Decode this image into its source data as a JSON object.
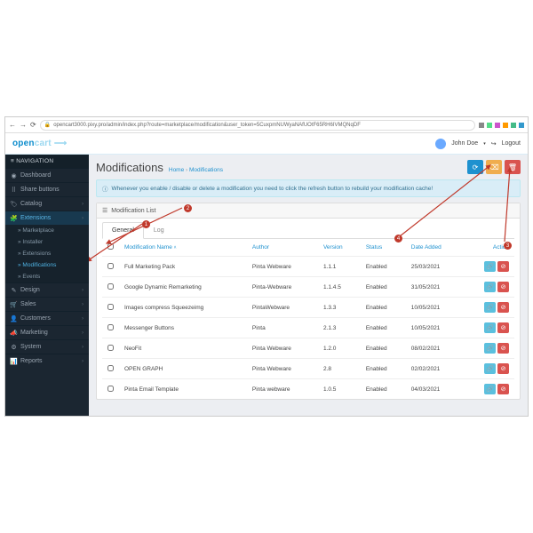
{
  "browser": {
    "url": "opencart3000.pixy.pro/admin/index.php?route=marketplace/modification&user_token=5CuxpmNUWyaNAfUOtF65RH6IVMQNqDF"
  },
  "brand": {
    "name_a": "open",
    "name_b": "cart"
  },
  "user": {
    "name": "John Doe",
    "logout": "Logout"
  },
  "sidebar": {
    "header": "NAVIGATION",
    "items": [
      {
        "icon": "◉",
        "label": "Dashboard",
        "expand": false
      },
      {
        "icon": "⠿",
        "label": "Share buttons",
        "expand": false
      },
      {
        "icon": "🏷",
        "label": "Catalog",
        "expand": true
      },
      {
        "icon": "🧩",
        "label": "Extensions",
        "expand": true,
        "active": true
      },
      {
        "icon": "✎",
        "label": "Design",
        "expand": true
      },
      {
        "icon": "🛒",
        "label": "Sales",
        "expand": true
      },
      {
        "icon": "👤",
        "label": "Customers",
        "expand": true
      },
      {
        "icon": "📣",
        "label": "Marketing",
        "expand": true
      },
      {
        "icon": "⚙",
        "label": "System",
        "expand": true
      },
      {
        "icon": "📊",
        "label": "Reports",
        "expand": true
      }
    ],
    "sub": {
      "marketplace": "Marketplace",
      "installer": "Installer",
      "extensions": "Extensions",
      "modifications": "Modifications",
      "events": "Events"
    }
  },
  "page": {
    "title": "Modifications",
    "crumb_home": "Home",
    "crumb_here": "Modifications",
    "alert": "Whenever you enable / disable or delete a modification you need to click the refresh button to rebuild your modification cache!",
    "panel_title": "Modification List",
    "tabs": {
      "general": "General",
      "log": "Log"
    },
    "cols": {
      "name": "Modification Name",
      "author": "Author",
      "version": "Version",
      "status": "Status",
      "date": "Date Added",
      "action": "Action"
    }
  },
  "rows": [
    {
      "name": "Full Marketing Pack",
      "author": "Pinta Webware",
      "version": "1.1.1",
      "status": "Enabled",
      "date": "25/03/2021"
    },
    {
      "name": "Google Dynamic Remarketing",
      "author": "Pinta-Webware",
      "version": "1.1.4.5",
      "status": "Enabled",
      "date": "31/05/2021"
    },
    {
      "name": "Images compress Squeezeimg",
      "author": "PintaWebware",
      "version": "1.3.3",
      "status": "Enabled",
      "date": "10/05/2021"
    },
    {
      "name": "Messenger Buttons",
      "author": "Pinta",
      "version": "2.1.3",
      "status": "Enabled",
      "date": "10/05/2021"
    },
    {
      "name": "NeoFit",
      "author": "Pinta Webware",
      "version": "1.2.0",
      "status": "Enabled",
      "date": "08/02/2021"
    },
    {
      "name": "OPEN GRAPH",
      "author": "Pinta Webware",
      "version": "2.8",
      "status": "Enabled",
      "date": "02/02/2021"
    },
    {
      "name": "Pinta Email Template",
      "author": "Pinta webware",
      "version": "1.0.5",
      "status": "Enabled",
      "date": "04/03/2021"
    }
  ],
  "ann": {
    "n1": "1",
    "n2": "2",
    "n3": "3",
    "n4": "4"
  }
}
